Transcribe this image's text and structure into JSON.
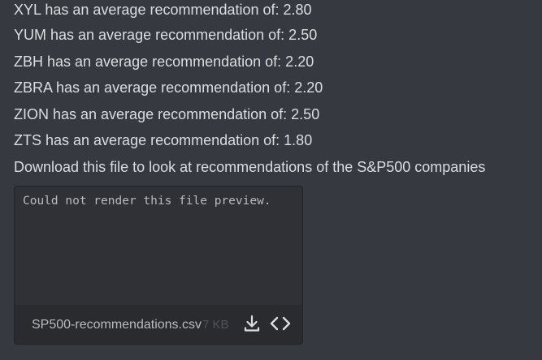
{
  "messages": [
    "XYL has an average recommendation of: 2.80",
    "YUM has an average recommendation of: 2.50",
    "ZBH has an average recommendation of: 2.20",
    "ZBRA has an average recommendation of: 2.20",
    "ZION has an average recommendation of: 2.50",
    "ZTS has an average recommendation of: 1.80",
    "Download this file to look at recommendations of the S&P500 companies"
  ],
  "attachment": {
    "preview_error": "Could not render this file preview.",
    "filename": "SP500-recommendations.csv",
    "size": "7 KB",
    "download_icon": "download-icon",
    "code_icon": "code-icon"
  },
  "colors": {
    "background": "#36393f",
    "text": "#dcddde",
    "attachment_bg": "#2f3136",
    "footer_bg": "#292b2f"
  }
}
